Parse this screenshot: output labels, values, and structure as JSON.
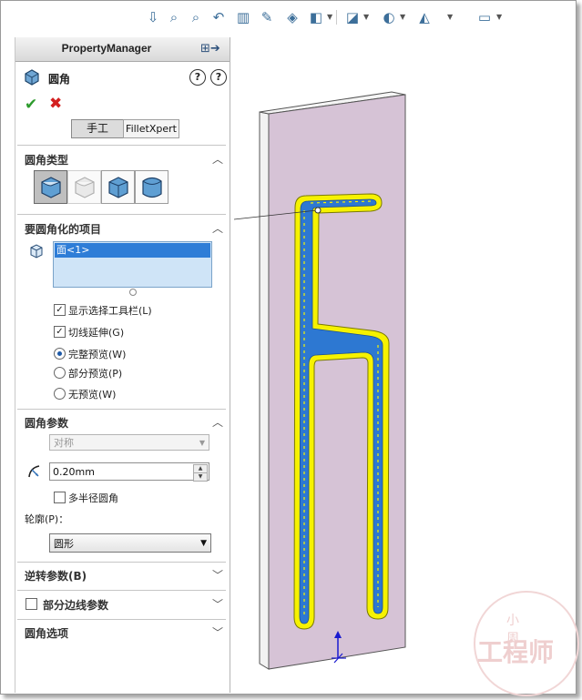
{
  "toolbar": {
    "icons": [
      "view-orientation-icon",
      "zoom-to-fit-icon",
      "zoom-area-icon",
      "previous-view-icon",
      "section-view-icon",
      "dynamic-annotation-icon",
      "view-orientation-cube-icon",
      "display-style-icon",
      "hide-show-items-icon",
      "edit-appearance-icon",
      "apply-scene-icon",
      "view-settings-icon"
    ]
  },
  "property_manager": {
    "title": "PropertyManager",
    "feature_name": "圆角",
    "help_a": "?",
    "help_b": "?",
    "ok": "✔",
    "cancel": "✖",
    "tabs": {
      "manual": "手工",
      "filletxpert": "FilletXpert"
    },
    "sections": {
      "fillet_type": {
        "title": "圆角类型"
      },
      "items": {
        "title": "要圆角化的项目",
        "selection": "面<1>",
        "options": [
          {
            "label": "显示选择工具栏(L)",
            "checked": true
          },
          {
            "label": "切线延伸(G)",
            "checked": true
          }
        ],
        "radios": [
          {
            "label": "完整预览(W)",
            "selected": true
          },
          {
            "label": "部分预览(P)",
            "selected": false
          },
          {
            "label": "无预览(W)",
            "selected": false
          }
        ]
      },
      "params": {
        "title": "圆角参数",
        "method": "对称",
        "radius": "0.20mm",
        "multi_radius_label": "多半径圆角",
        "multi_radius_checked": false,
        "profile_label": "轮廓(P)：",
        "profile": "圆形"
      },
      "setback": {
        "title": "逆转参数(B)"
      },
      "partial_edge": {
        "title": "部分边线参数",
        "checked": false
      },
      "fillet_options": {
        "title": "圆角选项"
      }
    }
  },
  "watermark": {
    "small": "小 周",
    "main": "工程师"
  },
  "colors": {
    "part_face": "#d6c3d6",
    "selection_blue": "#2e7dd7",
    "highlight_yellow": "#f4f400",
    "ok_green": "#2d9b2d",
    "cancel_red": "#d32020"
  }
}
